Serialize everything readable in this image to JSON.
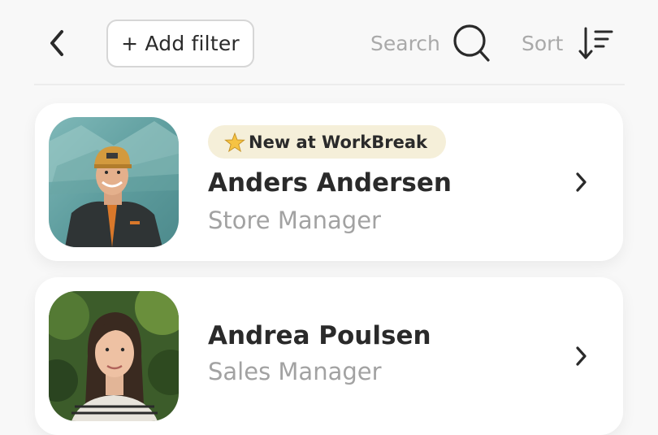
{
  "toolbar": {
    "add_filter_label": "+ Add filter",
    "search_label": "Search",
    "sort_label": "Sort"
  },
  "people": [
    {
      "badge": {
        "icon": "star-icon",
        "label": "New at WorkBreak"
      },
      "name": "Anders Andersen",
      "role": "Store Manager",
      "photo": "portrait-man-orange-cap-outdoors"
    },
    {
      "name": "Andrea Poulsen",
      "role": "Sales Manager",
      "photo": "portrait-woman-dark-hair-greenery"
    }
  ],
  "colors": {
    "background": "#f8f8f8",
    "card": "#ffffff",
    "badge_bg": "#f5efd9",
    "muted_text": "#a9a9a9",
    "primary_text": "#2a2a2a"
  }
}
